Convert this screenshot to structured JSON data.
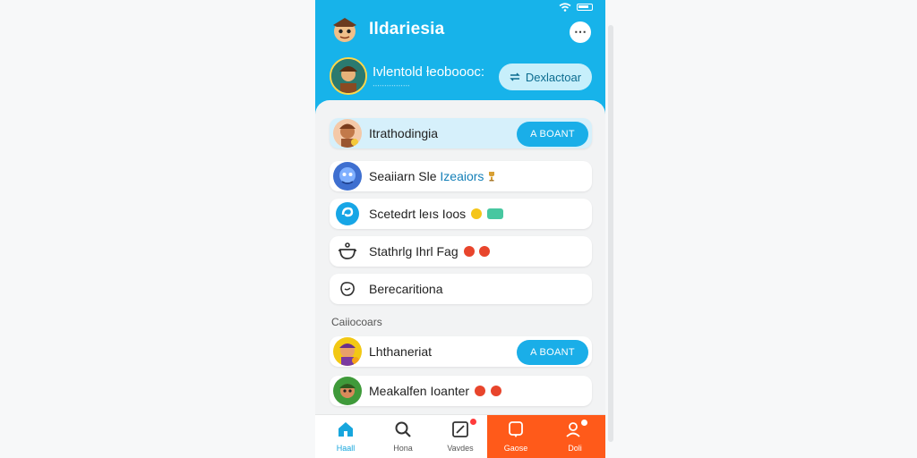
{
  "app": {
    "title": "Ildariesia",
    "menu_label": "⋯"
  },
  "profile": {
    "name": "Ivlentold ƚeoboooc:",
    "subtitle": "ᐧᐧᐧᐧᐧᐧᐧᐧᐧᐧᐧᐧᐧᐧᐧᐧ",
    "action_label": "Dexlactoar"
  },
  "list": [
    {
      "label": "Itrathodingia",
      "accent": "",
      "action": "A BOANT",
      "active": true,
      "icon": "avatar-character-icon"
    },
    {
      "label": "Seaiiarn Sle ",
      "accent": "Izeaiors",
      "action": "",
      "active": false,
      "icon": "avatar-blue-character-icon"
    },
    {
      "label": "Scetedrt leıs Ioos",
      "accent": "",
      "action": "",
      "active": false,
      "icon": "blue-swirl-icon"
    },
    {
      "label": "Stathrlg Ihrl Fag",
      "accent": "",
      "action": "",
      "active": false,
      "icon": "pot-icon"
    },
    {
      "label": "Berecaritiona",
      "accent": "",
      "action": "",
      "active": false,
      "icon": "leaf-outline-icon"
    }
  ],
  "section": {
    "title": "Caiiocoars"
  },
  "section_list": [
    {
      "label": "Lhthaneriat",
      "action": "A BOANT",
      "icon": "yellow-character-icon"
    },
    {
      "label": "Meakalfen Ioanter",
      "action": "",
      "icon": "green-character-icon"
    }
  ],
  "nav": [
    {
      "label": "Haall",
      "icon": "home-icon",
      "active": true
    },
    {
      "label": "Hona",
      "icon": "search-icon",
      "active": false
    },
    {
      "label": "Vavdes",
      "icon": "edit-icon",
      "active": false
    },
    {
      "label": "Gaose",
      "icon": "chat-icon",
      "active": false
    },
    {
      "label": "Doli",
      "icon": "profile-icon",
      "active": false
    }
  ],
  "colors": {
    "brand": "#17b3ea",
    "accent": "#1aaee8",
    "hot": "#ff5a1a"
  }
}
